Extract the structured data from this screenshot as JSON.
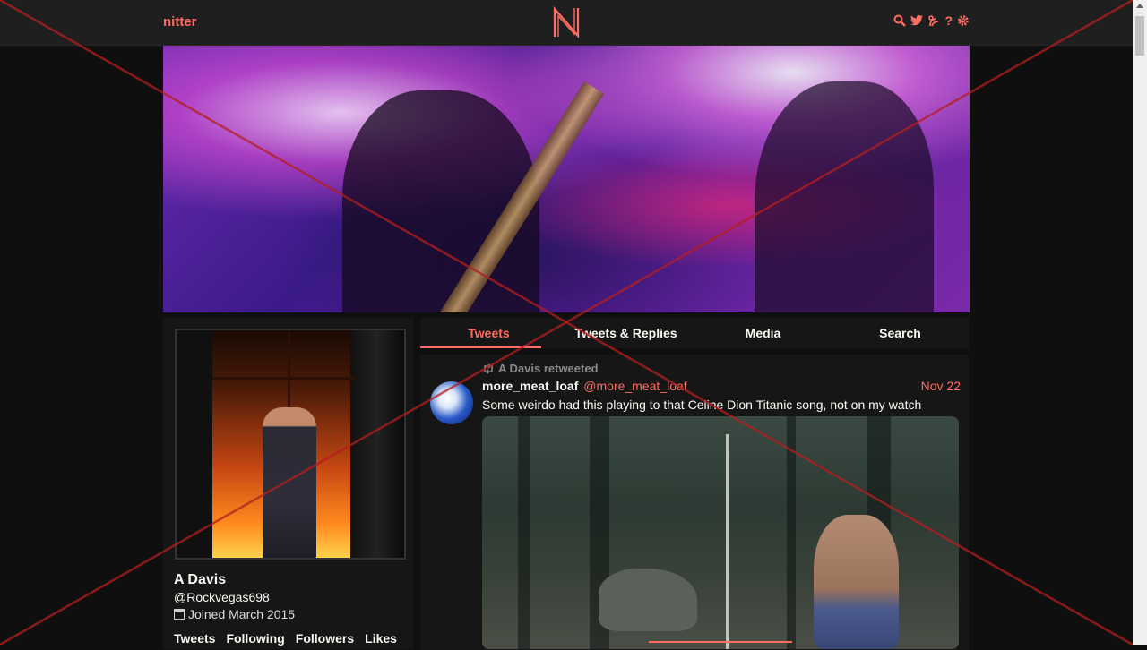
{
  "nav": {
    "brand": "nitter",
    "logo_letter": "N",
    "icons": [
      "search-icon",
      "twitter-bird-icon",
      "rss-icon",
      "help-icon",
      "gear-icon"
    ],
    "help_label": "?"
  },
  "tabs": [
    {
      "label": "Tweets",
      "active": true
    },
    {
      "label": "Tweets & Replies",
      "active": false
    },
    {
      "label": "Media",
      "active": false
    },
    {
      "label": "Search",
      "active": false
    }
  ],
  "profile": {
    "name": "A Davis",
    "handle": "@Rockvegas698",
    "joined": "Joined March 2015",
    "stats": [
      "Tweets",
      "Following",
      "Followers",
      "Likes"
    ]
  },
  "tweet": {
    "retweet_label": "A Davis retweeted",
    "fullname": "more_meat_loaf",
    "username": "@more_meat_loaf",
    "date": "Nov 22",
    "text": "Some weirdo had this playing to that Celine Dion Titanic song, not on my watch"
  },
  "colors": {
    "accent": "#ff6c60",
    "background": "#0f0f0f",
    "panel": "#161616",
    "navbar": "#1f1f1f",
    "overlay_cross": "#b41e1e"
  }
}
